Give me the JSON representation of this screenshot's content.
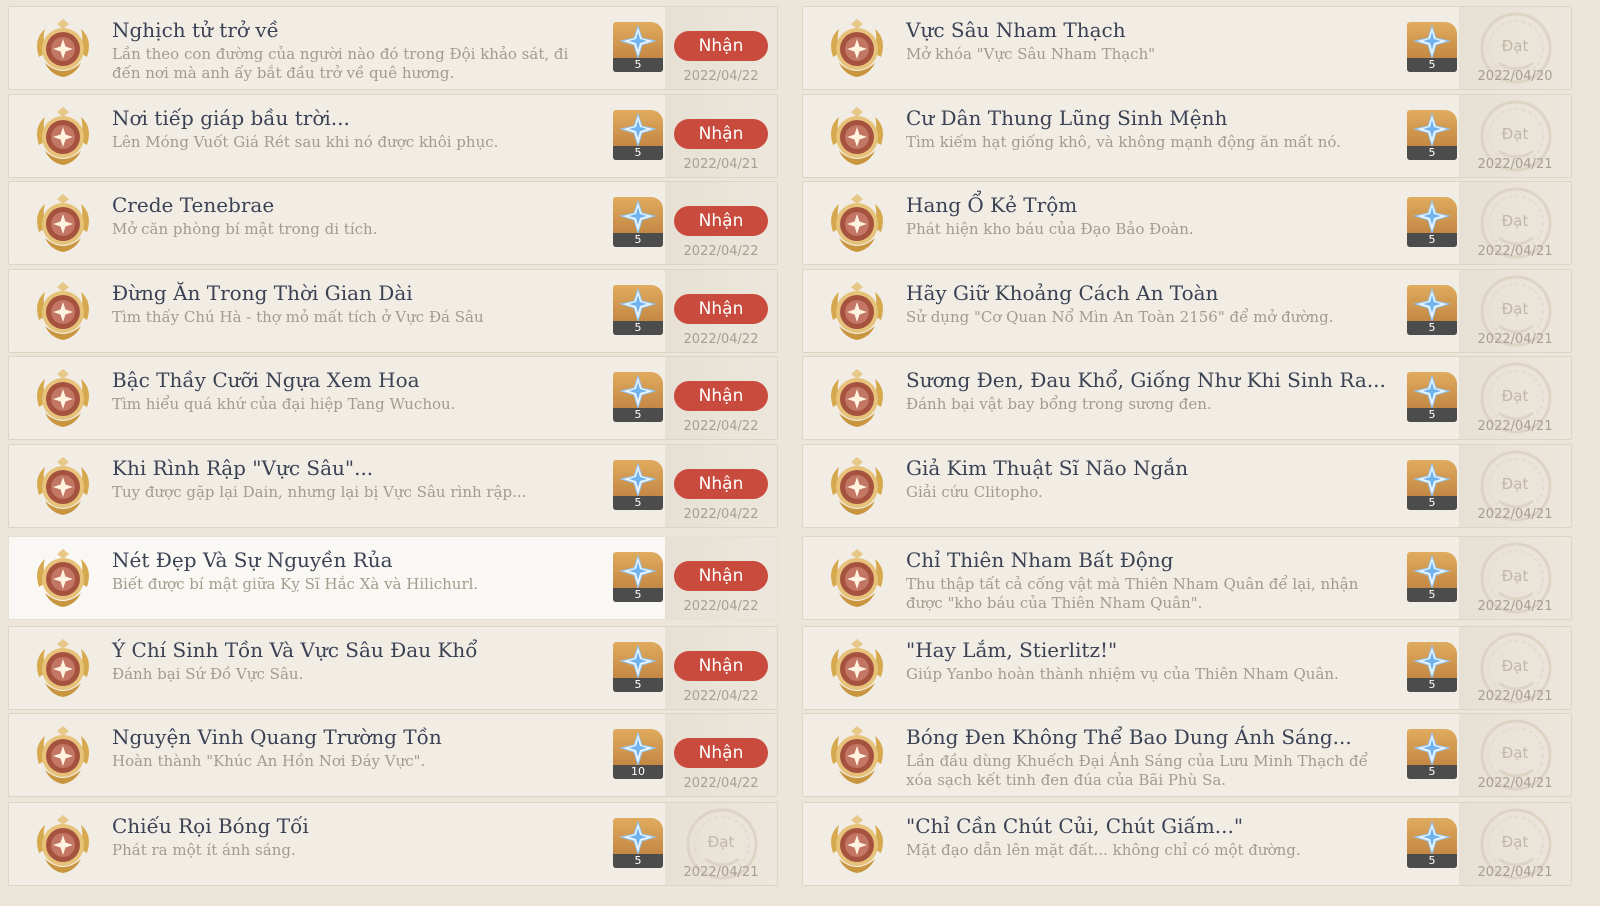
{
  "labels": {
    "claim": "Nhận",
    "done": "Đạt"
  },
  "colors": {
    "claim_button": "#c94b3d",
    "title_text": "#3b4254",
    "desc_text": "#a39b8c",
    "card_bg": "#f1ede5"
  },
  "icons": {
    "badge": "achievement-badge-icon",
    "reward": "primogem-icon"
  },
  "left": [
    {
      "title": "Nghịch tử trở về",
      "desc": "Lần theo con đường của người nào đó trong Đội khảo sát, đi đến nơi mà anh ấy bắt đầu trở về quê hương.",
      "reward_count": "5",
      "status": "claim",
      "date": "2022/04/22",
      "highlight": false
    },
    {
      "title": "Nơi tiếp giáp bầu trời...",
      "desc": "Lên Móng Vuốt Giá Rét sau khi nó được khôi phục.",
      "reward_count": "5",
      "status": "claim",
      "date": "2022/04/21",
      "highlight": false
    },
    {
      "title": "Crede Tenebrae",
      "desc": "Mở căn phòng bí mật trong di tích.",
      "reward_count": "5",
      "status": "claim",
      "date": "2022/04/22",
      "highlight": false
    },
    {
      "title": "Đừng Ăn Trong Thời Gian Dài",
      "desc": "Tìm thấy Chú Hà - thợ mỏ mất tích ở Vực Đá Sâu",
      "reward_count": "5",
      "status": "claim",
      "date": "2022/04/22",
      "highlight": false
    },
    {
      "title": "Bậc Thầy Cưỡi Ngựa Xem Hoa",
      "desc": "Tìm hiểu quá khứ của đại hiệp Tang Wuchou.",
      "reward_count": "5",
      "status": "claim",
      "date": "2022/04/22",
      "highlight": false
    },
    {
      "title": "Khi Rình Rập \"Vực Sâu\"...",
      "desc": "Tuy được gặp lại Dain, nhưng lại bị Vực Sâu rình rập...",
      "reward_count": "5",
      "status": "claim",
      "date": "2022/04/22",
      "highlight": false
    },
    {
      "title": "Nét Đẹp Và Sự Nguyền Rủa",
      "desc": "Biết được bí mật giữa Kỵ Sĩ Hắc Xà và Hilichurl.",
      "reward_count": "5",
      "status": "claim",
      "date": "2022/04/22",
      "highlight": true
    },
    {
      "title": "Ý Chí Sinh Tồn Và Vực Sâu Đau Khổ",
      "desc": "Đánh bại Sứ Đồ Vực Sâu.",
      "reward_count": "5",
      "status": "claim",
      "date": "2022/04/22",
      "highlight": false
    },
    {
      "title": "Nguyện Vinh Quang Trường Tồn",
      "desc": "Hoàn thành \"Khúc An Hồn Nơi Đáy Vực\".",
      "reward_count": "10",
      "status": "claim",
      "date": "2022/04/22",
      "highlight": false
    },
    {
      "title": "Chiếu Rọi Bóng Tối",
      "desc": "Phát ra một ít ánh sáng.",
      "reward_count": "5",
      "status": "done",
      "date": "2022/04/21",
      "highlight": false
    }
  ],
  "right": [
    {
      "title": "Vực Sâu Nham Thạch",
      "desc": "Mở khóa \"Vực Sâu Nham Thạch\"",
      "reward_count": "5",
      "status": "done",
      "date": "2022/04/20",
      "highlight": false
    },
    {
      "title": "Cư Dân Thung Lũng Sinh Mệnh",
      "desc": "Tìm kiếm hạt giống khô, và không mạnh động ăn mất nó.",
      "reward_count": "5",
      "status": "done",
      "date": "2022/04/21",
      "highlight": false
    },
    {
      "title": "Hang Ổ Kẻ Trộm",
      "desc": "Phát hiện kho báu của Đạo Bảo Đoàn.",
      "reward_count": "5",
      "status": "done",
      "date": "2022/04/21",
      "highlight": false
    },
    {
      "title": "Hãy Giữ Khoảng Cách An Toàn",
      "desc": "Sử dụng \"Cơ Quan Nổ Mìn An Toàn 2156\" để mở đường.",
      "reward_count": "5",
      "status": "done",
      "date": "2022/04/21",
      "highlight": false
    },
    {
      "title": "Sương Đen, Đau Khổ, Giống Như Khi Sinh Ra...",
      "desc": "Đánh bại vật bay bổng trong sương đen.",
      "reward_count": "5",
      "status": "done",
      "date": "2022/04/21",
      "highlight": false
    },
    {
      "title": "Giả Kim Thuật Sĩ Não Ngắn",
      "desc": "Giải cứu Clitopho.",
      "reward_count": "5",
      "status": "done",
      "date": "2022/04/21",
      "highlight": false
    },
    {
      "title": "Chỉ Thiên Nham Bất Động",
      "desc": "Thu thập tất cả cống vật mà Thiên Nham Quân để lại, nhận được \"kho báu của Thiên Nham Quân\".",
      "reward_count": "5",
      "status": "done",
      "date": "2022/04/21",
      "highlight": false
    },
    {
      "title": "\"Hay Lắm, Stierlitz!\"",
      "desc": "Giúp Yanbo hoàn thành nhiệm vụ của Thiên Nham Quân.",
      "reward_count": "5",
      "status": "done",
      "date": "2022/04/21",
      "highlight": false
    },
    {
      "title": "Bóng Đen Không Thể Bao Dung Ánh Sáng...",
      "desc": "Lần đầu dùng Khuếch Đại Ánh Sáng của Lưu Minh Thạch để xóa sạch kết tinh đen đúa của Bãi Phù Sa.",
      "reward_count": "5",
      "status": "done",
      "date": "2022/04/21",
      "highlight": false
    },
    {
      "title": "\"Chỉ Cần Chút Củi, Chút Giấm...\"",
      "desc": "Mặt đạo dẫn lên mặt đất... không chỉ có một đường.",
      "reward_count": "5",
      "status": "done",
      "date": "2022/04/21",
      "highlight": false
    }
  ]
}
